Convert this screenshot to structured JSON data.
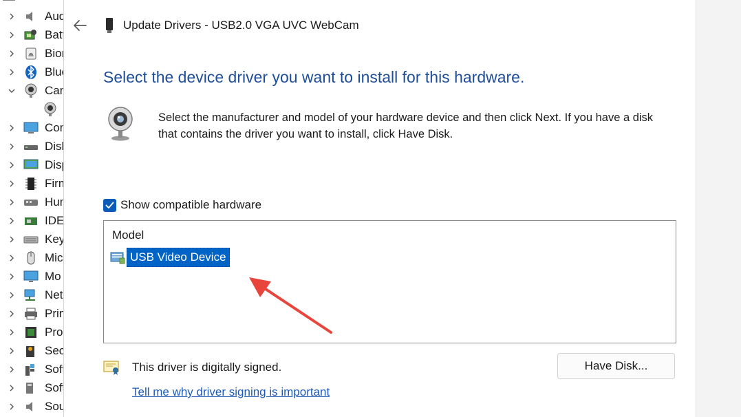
{
  "tree": {
    "items": [
      {
        "label": "Aud",
        "icon": "audio-icon",
        "expanded": false
      },
      {
        "label": "Batt",
        "icon": "battery-icon",
        "expanded": false
      },
      {
        "label": "Biom",
        "icon": "fingerprint-icon",
        "expanded": false
      },
      {
        "label": "Blue",
        "icon": "bluetooth-icon",
        "expanded": false
      },
      {
        "label": "Cam",
        "icon": "camera-icon",
        "expanded": true
      },
      {
        "label": "",
        "icon": "webcam-child-icon",
        "expanded": null
      },
      {
        "label": "Com",
        "icon": "computer-icon",
        "expanded": false
      },
      {
        "label": "Disk",
        "icon": "disk-drive-icon",
        "expanded": false
      },
      {
        "label": "Disp",
        "icon": "display-adapter-icon",
        "expanded": false
      },
      {
        "label": "Firm",
        "icon": "firmware-icon",
        "expanded": false
      },
      {
        "label": "Hum",
        "icon": "hid-icon",
        "expanded": false
      },
      {
        "label": "IDE",
        "icon": "ide-controller-icon",
        "expanded": false
      },
      {
        "label": "Key",
        "icon": "keyboard-icon",
        "expanded": false
      },
      {
        "label": "Mic",
        "icon": "mouse-icon",
        "expanded": false
      },
      {
        "label": "Mo",
        "icon": "monitor-icon",
        "expanded": false
      },
      {
        "label": "Net",
        "icon": "network-icon",
        "expanded": false
      },
      {
        "label": "Prin",
        "icon": "printer-icon",
        "expanded": false
      },
      {
        "label": "Proc",
        "icon": "processor-icon",
        "expanded": false
      },
      {
        "label": "Secu",
        "icon": "security-device-icon",
        "expanded": false
      },
      {
        "label": "Soft",
        "icon": "software-component-icon",
        "expanded": false
      },
      {
        "label": "Soft",
        "icon": "software-device-icon",
        "expanded": false
      },
      {
        "label": "Sou",
        "icon": "sound-icon",
        "expanded": false
      }
    ]
  },
  "dialog": {
    "title": "Update Drivers - USB2.0 VGA UVC WebCam",
    "heading": "Select the device driver you want to install for this hardware.",
    "instructions": "Select the manufacturer and model of your hardware device and then click Next. If you have a disk that contains the driver you want to install, click Have Disk.",
    "show_compatible_label": "Show compatible hardware",
    "show_compatible_checked": true,
    "model_header": "Model",
    "models": [
      {
        "label": "USB Video Device",
        "selected": true
      }
    ],
    "signed_text": "This driver is digitally signed.",
    "signing_link": "Tell me why driver signing is important",
    "have_disk_label": "Have Disk..."
  },
  "colors": {
    "heading": "#1e4e9a",
    "accent": "#0b5cb8",
    "selection": "#0063c6",
    "link": "#1e5bb8",
    "annotation_arrow": "#e8453c"
  }
}
